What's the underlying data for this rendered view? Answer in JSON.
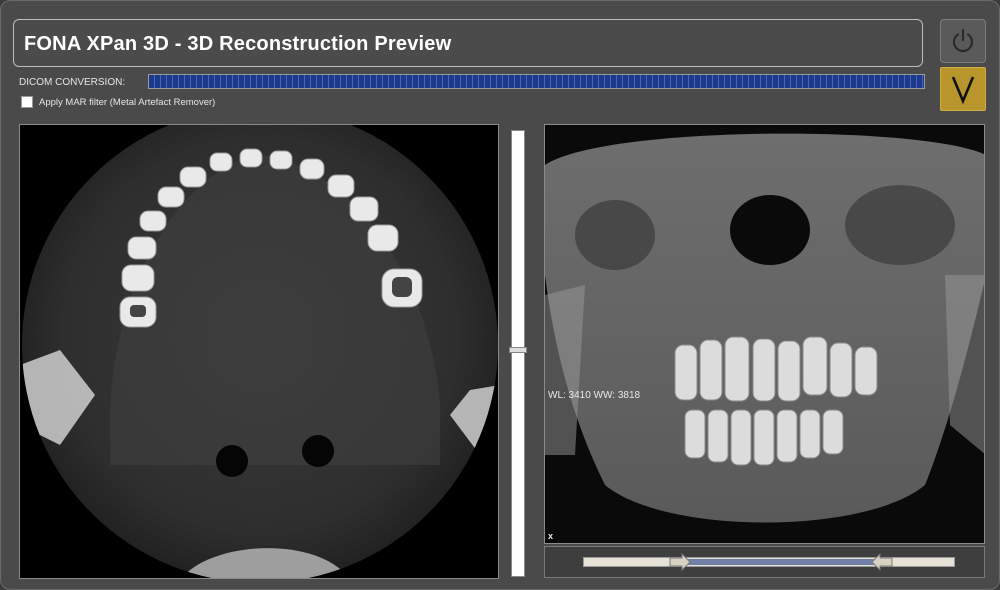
{
  "window": {
    "title": "FONA XPan 3D - 3D Reconstruction Preview"
  },
  "actions": {
    "power_icon": "power-icon",
    "confirm_icon": "checkmark-icon",
    "confirm_color": "#b8962c"
  },
  "conversion": {
    "label": "DICOM CONVERSION:",
    "progress": 1.0,
    "bar_color": "#1d3a8a"
  },
  "mar_filter": {
    "label": "Apply MAR filter (Metal Artefact Remover)",
    "checked": false
  },
  "views": {
    "axial": {
      "slice_position": 0.49
    },
    "volume": {
      "window_text": "WL: 3410 WW: 3818",
      "axis_label": "x",
      "range_low": 0.28,
      "range_high": 0.78
    }
  }
}
